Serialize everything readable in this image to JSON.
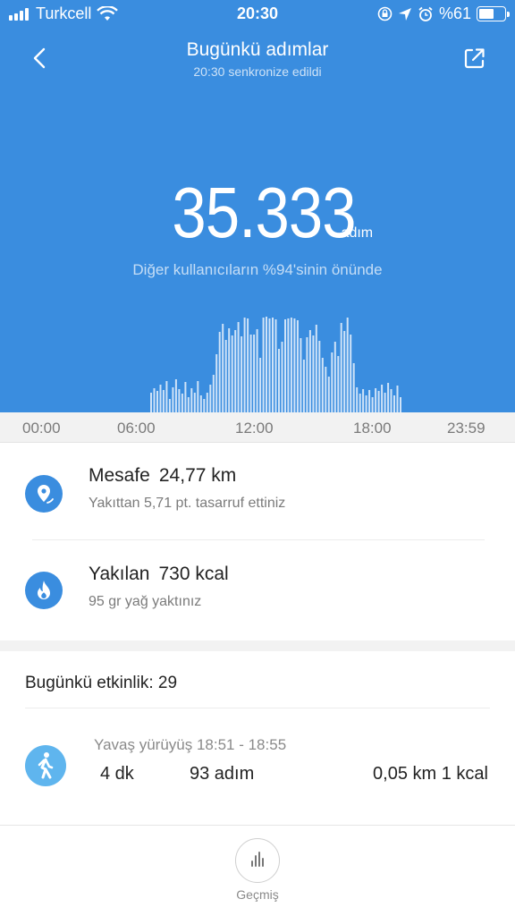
{
  "status_bar": {
    "carrier": "Turkcell",
    "time": "20:30",
    "battery_text": "%61",
    "battery_level": 0.61,
    "icons": [
      "signal-icon",
      "wifi-icon",
      "rotation-lock-icon",
      "location-icon",
      "alarm-icon",
      "battery-icon"
    ]
  },
  "header": {
    "title": "Bugünkü adımlar",
    "subtitle": "20:30 senkronize edildi",
    "back_icon": "chevron-left-icon",
    "share_icon": "share-icon"
  },
  "summary": {
    "steps": "35.333",
    "unit": "adım",
    "rank_text": "Diğer kullanıcıların %94'sinin önünde"
  },
  "timeline": {
    "labels": [
      "00:00",
      "06:00",
      "12:00",
      "18:00",
      "23:59"
    ],
    "bar_levels": [
      0.19,
      0.23,
      0.2,
      0.26,
      0.21,
      0.3,
      0.13,
      0.24,
      0.31,
      0.22,
      0.18,
      0.29,
      0.14,
      0.23,
      0.19,
      0.3,
      0.16,
      0.13,
      0.19,
      0.26,
      0.36,
      0.55,
      0.76,
      0.84,
      0.69,
      0.8,
      0.73,
      0.78,
      0.86,
      0.72,
      0.9,
      0.89,
      0.74,
      0.74,
      0.79,
      0.52,
      0.9,
      0.91,
      0.89,
      0.9,
      0.88,
      0.6,
      0.67,
      0.88,
      0.89,
      0.9,
      0.89,
      0.87,
      0.7,
      0.5,
      0.71,
      0.78,
      0.73,
      0.83,
      0.68,
      0.52,
      0.43,
      0.34,
      0.57,
      0.67,
      0.53,
      0.85,
      0.77,
      0.9,
      0.74,
      0.47,
      0.24,
      0.18,
      0.22,
      0.16,
      0.21,
      0.14,
      0.23,
      0.2,
      0.26,
      0.19,
      0.28,
      0.22,
      0.16,
      0.25,
      0.14
    ]
  },
  "stats": [
    {
      "icon": "location-pin-icon",
      "label": "Mesafe",
      "value": "24,77 km",
      "sub": "Yakıttan 5,71 pt. tasarruf ettiniz"
    },
    {
      "icon": "flame-icon",
      "label": "Yakılan",
      "value": "730 kcal",
      "sub": "95 gr yağ yaktınız"
    }
  ],
  "activity": {
    "header": "Bugünkü etkinlik: 29",
    "item": {
      "icon": "walking-person-icon",
      "name": "Yavaş yürüyüş 18:51 - 18:55",
      "duration": "4  dk",
      "steps": "93 adım",
      "distance_cal": "0,05 km 1 kcal"
    }
  },
  "tabbar": {
    "icon": "bar-chart-icon",
    "label": "Geçmiş"
  },
  "colors": {
    "header_blue": "#3a8ddf",
    "activity_icon_blue": "#5fb5ee",
    "bar_color": "#cfe3f8"
  }
}
